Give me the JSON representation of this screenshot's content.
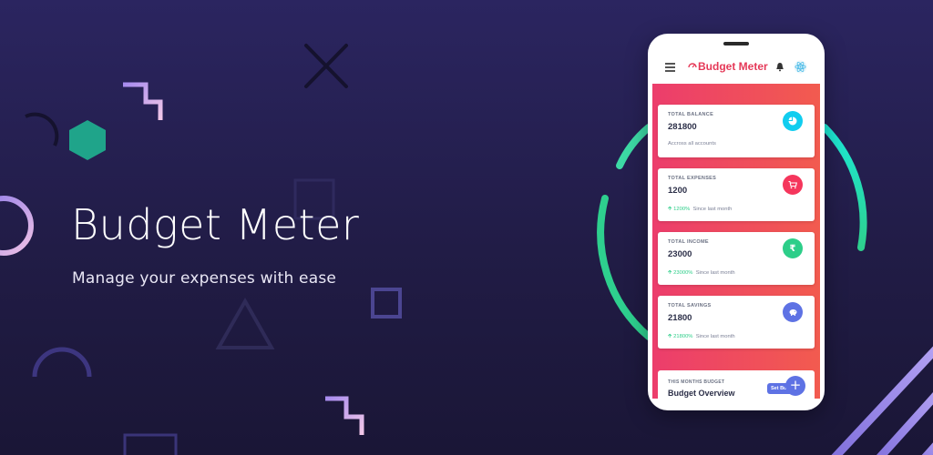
{
  "hero": {
    "title": "Budget Meter",
    "subtitle": "Manage your expenses with ease"
  },
  "app": {
    "title": "Budget Meter",
    "brand_color": "#e53958",
    "gradient": [
      "#ec3d6c",
      "#f25b4f"
    ]
  },
  "cards": [
    {
      "label": "TOTAL BALANCE",
      "value": "281800",
      "footer_text": "Accross all accounts",
      "footer_pct": "",
      "icon": "pie-chart-icon",
      "icon_color": "#11cdef"
    },
    {
      "label": "TOTAL EXPENSES",
      "value": "1200",
      "footer_pct": "1200%",
      "footer_text": "Since last month",
      "icon": "cart-icon",
      "icon_color": "#f5365c"
    },
    {
      "label": "TOTAL INCOME",
      "value": "23000",
      "footer_pct": "23000%",
      "footer_text": "Since last month",
      "icon": "rupee-icon",
      "icon_color": "#2dce89"
    },
    {
      "label": "TOTAL SAVINGS",
      "value": "21800",
      "footer_pct": "21800%",
      "footer_text": "Since last month",
      "icon": "piggy-bank-icon",
      "icon_color": "#5e72e4"
    }
  ],
  "budget": {
    "label": "THIS MONTHS BUDGET",
    "title": "Budget Overview",
    "set_button": "Set Bu",
    "add_icon": "plus-icon"
  },
  "colors": {
    "background_top": "#2b2560",
    "background_bottom": "#1a1636",
    "accent_green": "#2dce89",
    "accent_cyan": "#1de9d6",
    "accent_purple": "#b49af0"
  }
}
